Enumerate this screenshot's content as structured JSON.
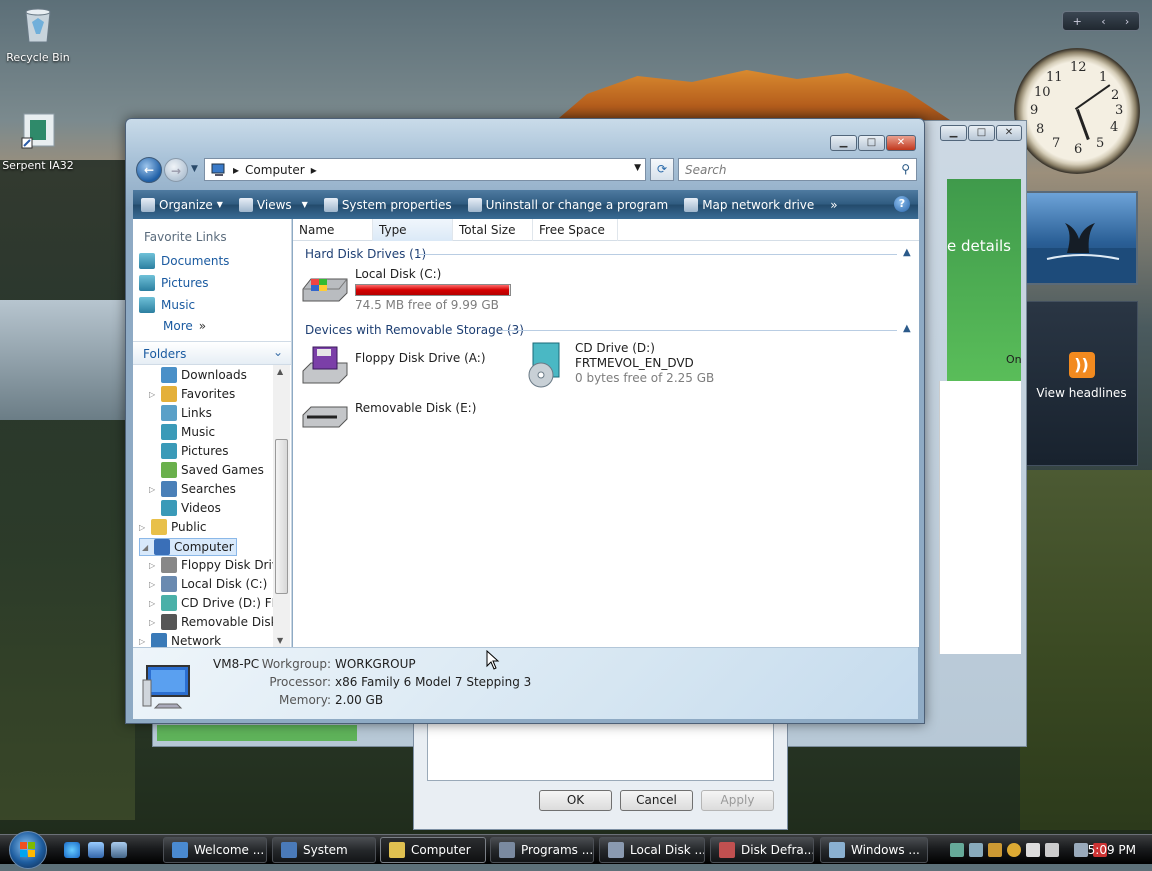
{
  "desktop": {
    "icons": [
      {
        "label": "Recycle Bin"
      },
      {
        "label": "Serpent IA32"
      }
    ]
  },
  "gadgets": {
    "clock_numbers": [
      "12",
      "1",
      "2",
      "3",
      "4",
      "5",
      "6",
      "7",
      "8",
      "9",
      "10",
      "11"
    ],
    "news_label": "View headlines",
    "rss_glyph": "))"
  },
  "background_window": {
    "partial_text": "e details",
    "partial_text2": "On",
    "dialog_buttons": {
      "ok": "OK",
      "cancel": "Cancel",
      "apply": "Apply"
    }
  },
  "window": {
    "caption_buttons": {
      "minimize": "▁",
      "maximize": "□",
      "close": "✕"
    },
    "address": {
      "segments": [
        "Computer"
      ],
      "arrow": "▸"
    },
    "search_placeholder": "Search",
    "toolbar": [
      {
        "label": "Organize",
        "dropdown": true
      },
      {
        "label": "Views",
        "dropdown": true
      },
      {
        "label": "System properties"
      },
      {
        "label": "Uninstall or change a program"
      },
      {
        "label": "Map network drive"
      }
    ],
    "toolbar_more": "»",
    "help": "?",
    "favorite_links": {
      "header": "Favorite Links",
      "items": [
        "Documents",
        "Pictures",
        "Music"
      ],
      "more": "More"
    },
    "folders": {
      "header": "Folders",
      "items": [
        {
          "label": "Downloads",
          "indent": 2,
          "color": "#4a90c8"
        },
        {
          "label": "Favorites",
          "indent": 2,
          "color": "#e4b03a",
          "expand": true
        },
        {
          "label": "Links",
          "indent": 2,
          "color": "#5aa0c8"
        },
        {
          "label": "Music",
          "indent": 2,
          "color": "#3a9ab8"
        },
        {
          "label": "Pictures",
          "indent": 2,
          "color": "#3a9ab8"
        },
        {
          "label": "Saved Games",
          "indent": 2,
          "color": "#6ab04c"
        },
        {
          "label": "Searches",
          "indent": 2,
          "color": "#4a80b8",
          "expand": true
        },
        {
          "label": "Videos",
          "indent": 2,
          "color": "#3a9ab8"
        },
        {
          "label": "Public",
          "indent": 1,
          "color": "#e8c04a",
          "expand": true
        },
        {
          "label": "Computer",
          "indent": 1,
          "color": "#3a6fb8",
          "selected": true,
          "expanded": true
        },
        {
          "label": "Floppy Disk Drive",
          "indent": 2,
          "color": "#888",
          "expand": true
        },
        {
          "label": "Local Disk (C:)",
          "indent": 2,
          "color": "#6a8ab0",
          "expand": true
        },
        {
          "label": "CD Drive (D:) FRT",
          "indent": 2,
          "color": "#4ab0a8",
          "expand": true
        },
        {
          "label": "Removable Disk",
          "indent": 2,
          "color": "#555",
          "expand": true
        },
        {
          "label": "Network",
          "indent": 1,
          "color": "#3a7ab8",
          "expand": true
        }
      ]
    },
    "columns": [
      "Name",
      "Type",
      "Total Size",
      "Free Space"
    ],
    "groups": [
      {
        "title": "Hard Disk Drives (1)"
      },
      {
        "title": "Devices with Removable Storage (3)"
      }
    ],
    "drives": {
      "local_c": {
        "name": "Local Disk (C:)",
        "free": "74.5 MB free of 9.99 GB",
        "used_fraction": 0.993
      },
      "floppy": {
        "name": "Floppy Disk Drive (A:)"
      },
      "cd": {
        "name": "CD Drive (D:)",
        "label": "FRTMEVOL_EN_DVD",
        "free": "0 bytes free of 2.25 GB"
      },
      "removable": {
        "name": "Removable Disk (E:)"
      }
    },
    "details": {
      "computer_name": "VM8-PC",
      "workgroup_label": "Workgroup:",
      "workgroup": "WORKGROUP",
      "processor_label": "Processor:",
      "processor": "x86 Family 6 Model 7 Stepping 3",
      "memory_label": "Memory:",
      "memory": "2.00 GB"
    }
  },
  "taskbar": {
    "tasks": [
      {
        "label": "Welcome ...",
        "color": "#4a8ad0"
      },
      {
        "label": "System",
        "color": "#4a7ab8"
      },
      {
        "label": "Computer",
        "color": "#e0c050",
        "active": true
      },
      {
        "label": "Programs ...",
        "color": "#7a8aa0"
      },
      {
        "label": "Local Disk ...",
        "color": "#8a9ab0"
      },
      {
        "label": "Disk Defra...",
        "color": "#c05050"
      },
      {
        "label": "Windows ...",
        "color": "#8ab0d0"
      }
    ],
    "time": "5:09 PM"
  }
}
